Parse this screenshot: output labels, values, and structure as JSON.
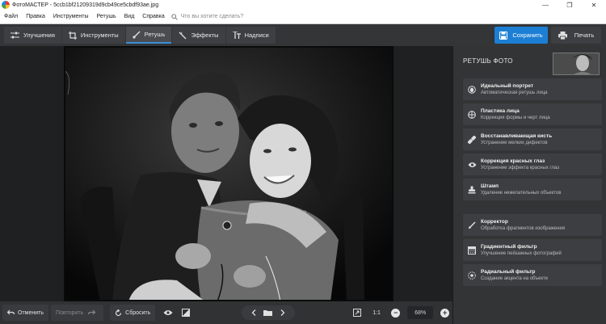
{
  "window": {
    "title": "ФотоМАСТЕР - 5ccb1bf21209319d9cb49ce5cbdf93ae.jpg",
    "controls": [
      "—",
      "❐",
      "✕"
    ]
  },
  "menu": {
    "items": [
      "Файл",
      "Правка",
      "Инструменты",
      "Ретушь",
      "Вид",
      "Справка"
    ],
    "search_placeholder": "Что вы хотите сделать?"
  },
  "toolbar": {
    "tabs": [
      "Улучшения",
      "Инструменты",
      "Ретушь",
      "Эффекты",
      "Надписи"
    ],
    "active_tab": "Ретушь",
    "save_label": "Сохранить",
    "print_label": "Печать"
  },
  "panel": {
    "title": "РЕТУШЬ ФОТО",
    "tools": [
      {
        "name": "Идеальный портрет",
        "desc": "Автоматическая ретушь лица",
        "icon": "portrait-icon"
      },
      {
        "name": "Пластика лица",
        "desc": "Коррекция формы и черт лица",
        "icon": "face-shape-icon"
      },
      {
        "name": "Восстанавливающая кисть",
        "desc": "Устранение мелких дефектов",
        "icon": "healing-brush-icon"
      },
      {
        "name": "Коррекция красных глаз",
        "desc": "Устранение эффекта красных глаз",
        "icon": "eye-icon"
      },
      {
        "name": "Штамп",
        "desc": "Удаление нежелательных объектов",
        "icon": "stamp-icon"
      },
      {
        "name": "Корректор",
        "desc": "Обработка фрагментов изображения",
        "icon": "brush-icon"
      },
      {
        "name": "Градиентный фильтр",
        "desc": "Улучшение пейзажных фотографий",
        "icon": "gradient-icon"
      },
      {
        "name": "Радиальный фильтр",
        "desc": "Создание акцента на объекте",
        "icon": "radial-icon"
      }
    ]
  },
  "bottom": {
    "undo_label": "Отменить",
    "redo_label": "Повторить",
    "reset_label": "Сбросить",
    "ratio_label": "1:1",
    "zoom_value": "68%"
  },
  "colors": {
    "accent": "#1c7fd4",
    "panel_bg": "#323436",
    "canvas_bg": "#1f2022"
  }
}
